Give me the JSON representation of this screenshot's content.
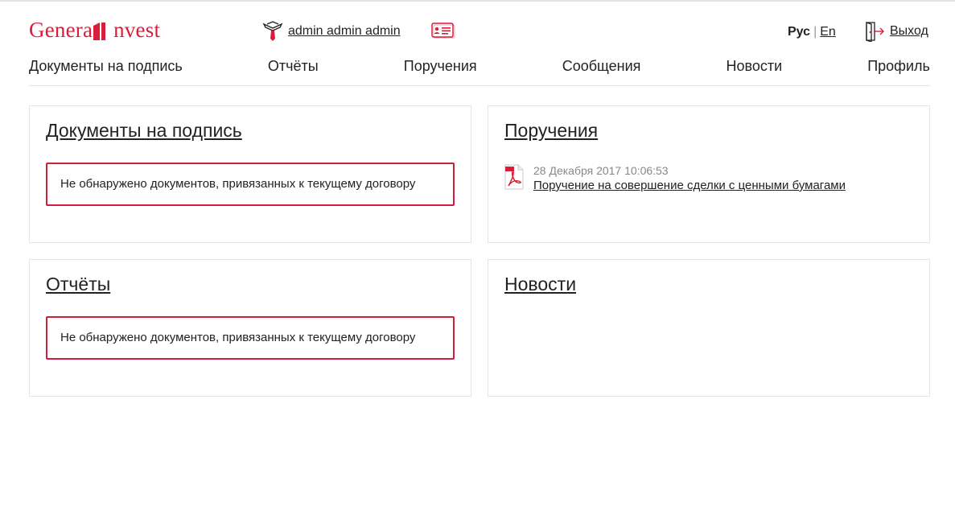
{
  "header": {
    "logo_left": "Genera",
    "logo_right": "nvest",
    "logo_full": "Genera Invest",
    "user_name": "admin admin admin",
    "lang_active": "Рус",
    "lang_separator": "|",
    "lang_other": "En",
    "logout_label": "Выход"
  },
  "nav": {
    "items": [
      {
        "label": "Документы на подпись"
      },
      {
        "label": "Отчёты"
      },
      {
        "label": "Поручения"
      },
      {
        "label": "Сообщения"
      },
      {
        "label": "Новости"
      },
      {
        "label": "Профиль"
      }
    ]
  },
  "panels": {
    "documents": {
      "title": "Документы на подпись",
      "notice": "Не обнаружено документов, привязанных к текущему договору"
    },
    "orders": {
      "title": "Поручения",
      "items": [
        {
          "date": "28 Декабря 2017 10:06:53",
          "title": "Поручение на совершение сделки с ценными бумагами",
          "icon": "pdf-icon"
        }
      ]
    },
    "reports": {
      "title": "Отчёты",
      "notice": "Не обнаружено документов, привязанных к текущему договору"
    },
    "news": {
      "title": "Новости"
    }
  },
  "colors": {
    "brand_red": "#d81e3a",
    "notice_border": "#cf1f3c",
    "panel_border": "#e6e6e6",
    "text": "#222222",
    "muted": "#888888"
  },
  "icons": {
    "user": "user-tie-icon",
    "card": "id-card-icon",
    "logout": "logout-door-icon",
    "logo": "logo-mark-icon"
  }
}
